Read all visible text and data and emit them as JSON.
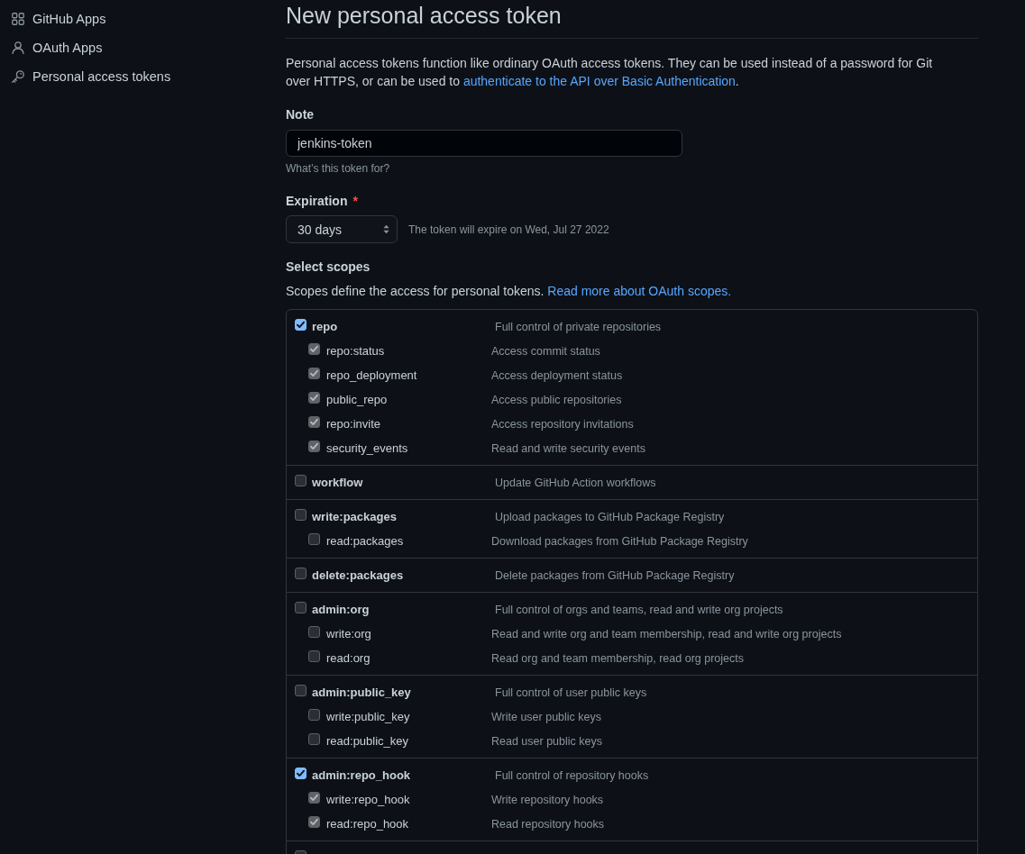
{
  "sidebar": {
    "items": [
      {
        "label": "GitHub Apps"
      },
      {
        "label": "OAuth Apps"
      },
      {
        "label": "Personal access tokens"
      }
    ]
  },
  "page": {
    "title": "New personal access token",
    "intro": {
      "text": "Personal access tokens function like ordinary OAuth access tokens. They can be used instead of a password for Git over HTTPS, or can be used to",
      "link": "authenticate to the API over Basic Authentication",
      "end": "."
    }
  },
  "note": {
    "label": "Note",
    "value": "jenkins-token",
    "hint": "What’s this token for?"
  },
  "expiration": {
    "label": "Expiration",
    "required_mark": "*",
    "value": "30 days",
    "hint": "The token will expire on Wed, Jul 27 2022"
  },
  "scopes": {
    "title": "Select scopes",
    "text": "Scopes define the access for personal tokens.",
    "link": "Read more about OAuth scopes.",
    "groups": [
      {
        "name": "repo",
        "description": "Full control of private repositories",
        "checked": true,
        "children": [
          {
            "name": "repo:status",
            "description": "Access commit status",
            "checked": true,
            "disabled": true
          },
          {
            "name": "repo_deployment",
            "description": "Access deployment status",
            "checked": true,
            "disabled": true
          },
          {
            "name": "public_repo",
            "description": "Access public repositories",
            "checked": true,
            "disabled": true
          },
          {
            "name": "repo:invite",
            "description": "Access repository invitations",
            "checked": true,
            "disabled": true
          },
          {
            "name": "security_events",
            "description": "Read and write security events",
            "checked": true,
            "disabled": true
          }
        ]
      },
      {
        "name": "workflow",
        "description": "Update GitHub Action workflows",
        "checked": false
      },
      {
        "name": "write:packages",
        "description": "Upload packages to GitHub Package Registry",
        "checked": false,
        "children": [
          {
            "name": "read:packages",
            "description": "Download packages from GitHub Package Registry",
            "checked": false,
            "disabled": false
          }
        ]
      },
      {
        "name": "delete:packages",
        "description": "Delete packages from GitHub Package Registry",
        "checked": false
      },
      {
        "name": "admin:org",
        "description": "Full control of orgs and teams, read and write org projects",
        "checked": false,
        "children": [
          {
            "name": "write:org",
            "description": "Read and write org and team membership, read and write org projects",
            "checked": false,
            "disabled": false
          },
          {
            "name": "read:org",
            "description": "Read org and team membership, read org projects",
            "checked": false,
            "disabled": false
          }
        ]
      },
      {
        "name": "admin:public_key",
        "description": "Full control of user public keys",
        "checked": false,
        "children": [
          {
            "name": "write:public_key",
            "description": "Write user public keys",
            "checked": false,
            "disabled": false
          },
          {
            "name": "read:public_key",
            "description": "Read user public keys",
            "checked": false,
            "disabled": false
          }
        ]
      },
      {
        "name": "admin:repo_hook",
        "description": "Full control of repository hooks",
        "checked": true,
        "children": [
          {
            "name": "write:repo_hook",
            "description": "Write repository hooks",
            "checked": true,
            "disabled": true
          },
          {
            "name": "read:repo_hook",
            "description": "Read repository hooks",
            "checked": true,
            "disabled": true
          }
        ]
      },
      {
        "checked": false
      }
    ]
  }
}
